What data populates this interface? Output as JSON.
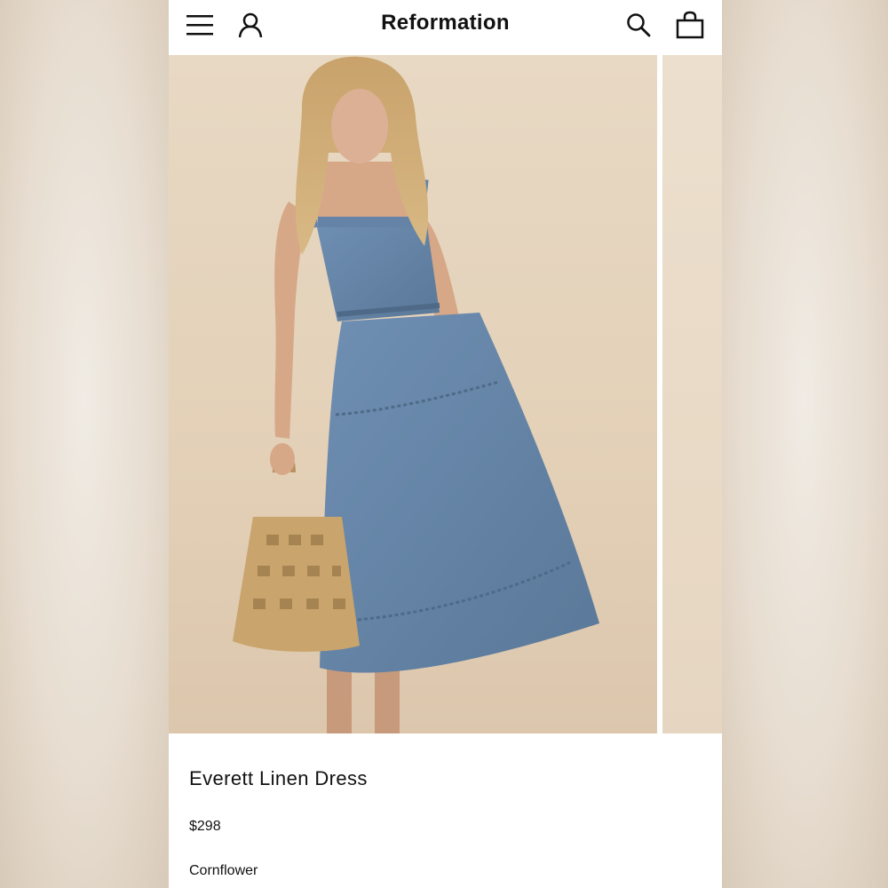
{
  "header": {
    "brand": "Reformation",
    "icons": {
      "menu": "menu-icon",
      "account": "account-icon",
      "search": "search-icon",
      "bag": "shopping-bag-icon"
    }
  },
  "product": {
    "name": "Everett Linen Dress",
    "price": "$298",
    "color_name": "Cornflower"
  },
  "colors": {
    "dress": "#6483a6",
    "background": "#e6d6c0",
    "text": "#111111"
  }
}
